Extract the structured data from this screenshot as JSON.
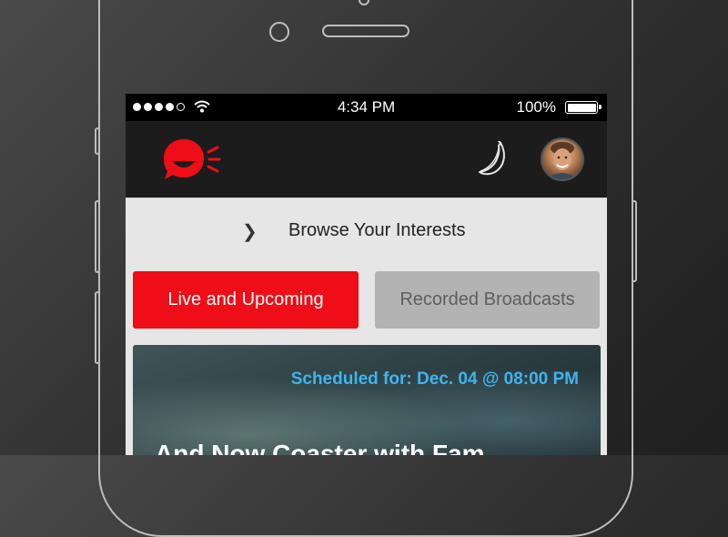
{
  "status_bar": {
    "time": "4:34 PM",
    "battery": "100%"
  },
  "header": {
    "logo_icon": "speech-bubble-logo-icon",
    "banana_icon": "banana-icon",
    "avatar": "user-avatar"
  },
  "browse": {
    "label": "Browse Your Interests"
  },
  "tabs": {
    "live": "Live and Upcoming",
    "recorded": "Recorded Broadcasts"
  },
  "card": {
    "schedule": "Scheduled for: Dec. 04 @ 08:00 PM",
    "title": "And Now Coaster with Fam"
  },
  "colors": {
    "accent": "#ef0d17",
    "schedule_text": "#3fb4ef",
    "header_bg": "#1c1c1c"
  }
}
